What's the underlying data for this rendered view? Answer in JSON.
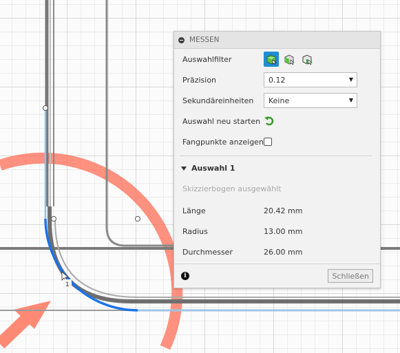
{
  "canvas": {
    "point_label": "1"
  },
  "panel": {
    "title": "MESSEN",
    "selection_filter": {
      "label": "Auswahlfilter",
      "icons": [
        "select-body-icon",
        "select-face-icon",
        "select-edge-icon"
      ],
      "active": "select-body-icon"
    },
    "precision": {
      "label": "Präzision",
      "value": "0.12"
    },
    "secondary_units": {
      "label": "Sekundäreinheiten",
      "value": "Keine"
    },
    "restart_selection": {
      "label": "Auswahl neu starten",
      "icon": "restart-arrow-icon"
    },
    "show_snap_points": {
      "label": "Fangpunkte anzeigen",
      "checked": false
    },
    "selection": {
      "title": "Auswahl 1",
      "hint": "Skizzierbogen ausgewählt",
      "length": {
        "label": "Länge",
        "value": "20.42 mm"
      },
      "radius": {
        "label": "Radius",
        "value": "13.00 mm"
      },
      "diameter": {
        "label": "Durchmesser",
        "value": "26.00 mm"
      }
    },
    "close_label": "Schließen"
  },
  "colors": {
    "accent": "#1e8dd6",
    "selection_blue": "#1a73e8",
    "triad_red": "#ff6e55"
  }
}
